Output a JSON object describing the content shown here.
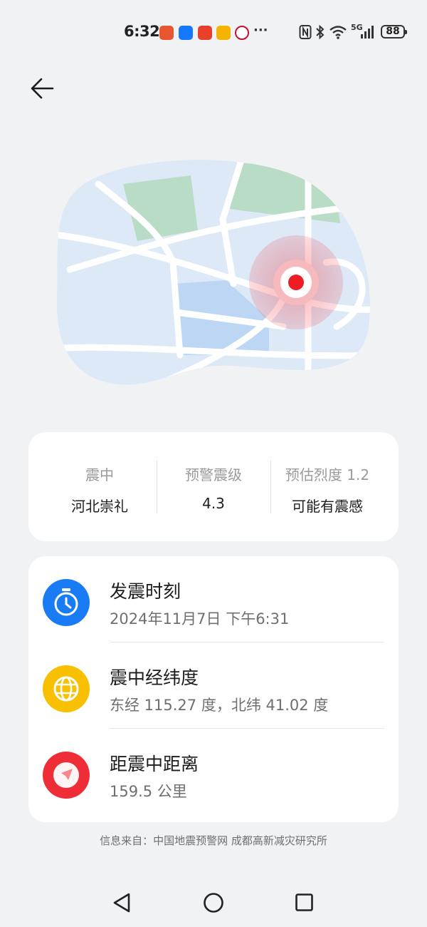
{
  "status_bar": {
    "time": "6:32",
    "more": "···",
    "network": "5G",
    "battery": "88",
    "icons": [
      "nfc-icon",
      "bluetooth-icon",
      "wifi-icon",
      "signal-icon"
    ],
    "app_icons": [
      "shield-app-icon",
      "chat-app-icon",
      "taobao-app-icon",
      "weibo-app-icon",
      "metro-app-icon"
    ],
    "app_colors": [
      "#e8552e",
      "#1677ff",
      "#e8402a",
      "#f5b400",
      "#c8102e"
    ]
  },
  "header": {
    "back_icon": "arrow-left-icon"
  },
  "map": {
    "colors": {
      "land": "#dde9f7",
      "water": "#bcd6f4",
      "park": "#b8dcc6",
      "road": "#ffffff",
      "epicenter": "#ee1c25"
    }
  },
  "summary": {
    "columns": [
      {
        "label": "震中",
        "value": "河北崇礼"
      },
      {
        "label": "预警震级",
        "value": "4.3"
      },
      {
        "label": "预估烈度 1.2",
        "value": "可能有震感"
      }
    ]
  },
  "details": {
    "rows": [
      {
        "icon": "clock-icon",
        "color": "#1a7cf5",
        "title": "发震时刻",
        "value": "2024年11月7日 下午6:31"
      },
      {
        "icon": "globe-icon",
        "color": "#f8c000",
        "title": "震中经纬度",
        "value": "东经 115.27 度，北纬 41.02 度"
      },
      {
        "icon": "location-arrow-icon",
        "color": "#ef2d37",
        "title": "距震中距离",
        "value": "159.5 公里"
      }
    ]
  },
  "source": "信息来自：中国地震预警网 成都高新减灾研究所",
  "nav": {
    "icons": [
      "nav-back-icon",
      "nav-home-icon",
      "nav-recents-icon"
    ]
  }
}
